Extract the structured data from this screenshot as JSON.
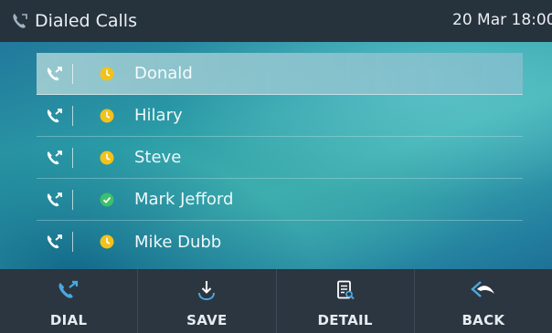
{
  "header": {
    "title": "Dialed Calls",
    "datetime": "20 Mar 18:00",
    "icon": "phone-history-icon"
  },
  "calls": [
    {
      "name": "Donald",
      "status": "missed-clock",
      "selected": true
    },
    {
      "name": "Hilary",
      "status": "missed-clock",
      "selected": false
    },
    {
      "name": "Steve",
      "status": "missed-clock",
      "selected": false
    },
    {
      "name": "Mark Jefford",
      "status": "answered-check",
      "selected": false
    },
    {
      "name": "Mike Dubb",
      "status": "missed-clock",
      "selected": false
    }
  ],
  "softkeys": [
    {
      "label": "DIAL",
      "icon": "dial-icon"
    },
    {
      "label": "SAVE",
      "icon": "save-icon"
    },
    {
      "label": "DETAIL",
      "icon": "detail-icon"
    },
    {
      "label": "BACK",
      "icon": "back-icon"
    }
  ],
  "colors": {
    "titlebar_bg": "#26323c",
    "softkey_bg": "#2c3640",
    "clock_yellow": "#f2c21b",
    "check_green": "#3cc06a",
    "accent_blue": "#4aa8e0"
  }
}
